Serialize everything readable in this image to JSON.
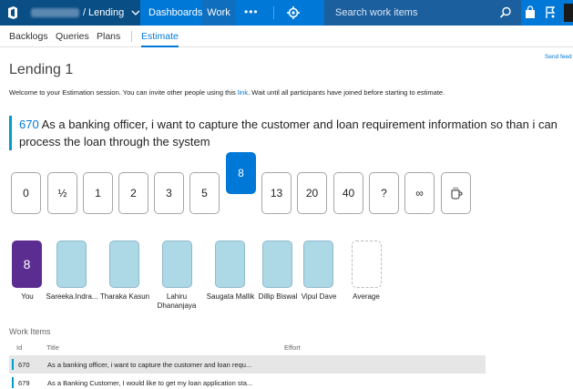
{
  "topbar": {
    "project": "/ Lending",
    "nav_dashboards": "Dashboards",
    "nav_work": "Work",
    "nav_more": "•••",
    "search_placeholder": "Search work items"
  },
  "subnav": {
    "items": [
      "Backlogs",
      "Queries",
      "Plans"
    ],
    "active": "Estimate"
  },
  "send_feedback": "Send feed",
  "session": {
    "title": "Lending 1",
    "welcome_before": "Welcome to your Estimation session. You can invite other people using this ",
    "welcome_link": "link",
    "welcome_after": ". Wait until all participants have joined before starting to estimate."
  },
  "story": {
    "id": "670",
    "text": "As a banking officer, i want to capture the customer and loan requirement information so than i can process the loan through the system"
  },
  "cards": [
    "0",
    "½",
    "1",
    "2",
    "3",
    "5",
    "8",
    "13",
    "20",
    "40",
    "?",
    "∞",
    "coffee"
  ],
  "selected_card": "8",
  "participants": [
    {
      "name": "You",
      "vote": "8"
    },
    {
      "name": "Sareeka.Indra...",
      "vote": ""
    },
    {
      "name": "Tharaka Kasun",
      "vote": ""
    },
    {
      "name": "Lahiru Dhananjaya",
      "vote": ""
    },
    {
      "name": "Saugata Mallik",
      "vote": ""
    },
    {
      "name": "Dillip Biswal",
      "vote": ""
    },
    {
      "name": "Vipul Dave",
      "vote": ""
    },
    {
      "name": "Average",
      "vote": ""
    }
  ],
  "work_items": {
    "title": "Work Items",
    "headers": {
      "id": "Id",
      "title": "Title",
      "effort": "Effort"
    },
    "rows": [
      {
        "id": "670",
        "title": "As a banking officer, i want to capture the customer and loan requ...",
        "effort": ""
      },
      {
        "id": "679",
        "title": "As a Banking Customer, I would like to get my loan application sta...",
        "effort": ""
      }
    ]
  },
  "colors": {
    "accent": "#0078d7",
    "topbar_dark": "#0a4e86",
    "my_vote": "#5c2d91",
    "pending_vote": "#add8e6",
    "story_bar": "#009ccc"
  }
}
